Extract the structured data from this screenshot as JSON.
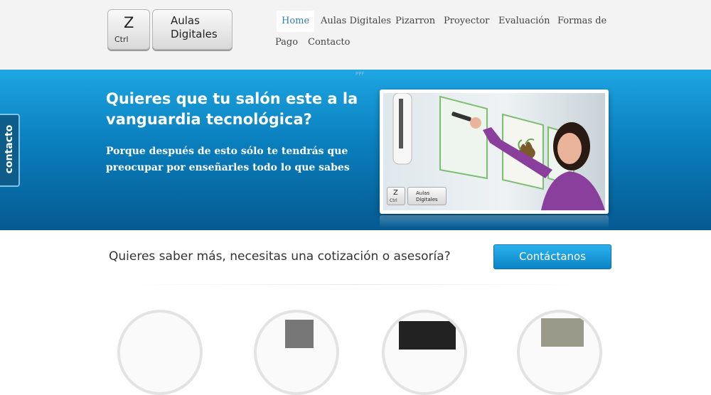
{
  "logo": {
    "key_letter": "Z",
    "key_modifier": "Ctrl",
    "brand_line1": "Aulas",
    "brand_line2": "Digitales"
  },
  "nav": {
    "items": [
      {
        "label": "Home",
        "active": true
      },
      {
        "label": "Aulas Digitales"
      },
      {
        "label": "Pizarron"
      },
      {
        "label": "Proyector"
      },
      {
        "label": "Evaluación"
      },
      {
        "label": "Formas de"
      },
      {
        "label": "Pago"
      },
      {
        "label": "Contacto"
      }
    ]
  },
  "hero": {
    "mark": "PPF",
    "title": "Quieres que tu salón este a la vanguardia tecnológica?",
    "subtitle": "Porque después de esto sólo te tendrás que preocupar por enseñarles todo lo que sabes",
    "photo_logo_letter": "Z",
    "photo_logo_modifier": "Ctrl",
    "photo_logo_line1": "Aulas",
    "photo_logo_line2": "Digitales"
  },
  "side_tab": {
    "label": "contacto"
  },
  "cta": {
    "text": "Quieres saber más, necesitas una cotización o asesoría?",
    "button_label": "Contáctanos"
  },
  "colors": {
    "accent": "#2f7fb0",
    "hero_top": "#1ea6e3",
    "hero_bottom": "#055a91",
    "button": "#0a84c6"
  }
}
